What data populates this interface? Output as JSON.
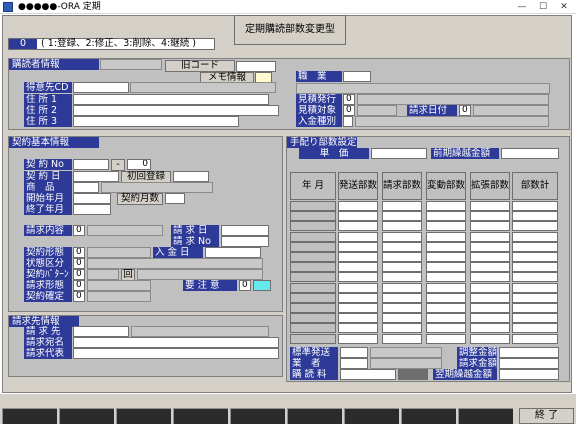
{
  "window": {
    "title": "●●●●●-ORA 定期",
    "buttons": {
      "minimize": "—",
      "maximize": "☐",
      "close": "✕"
    }
  },
  "header": {
    "screen_title": "定期購読部数変更型",
    "mode_value": "0",
    "mode_options": "( 1:登録、2:修正、3:削除、4:継続 )"
  },
  "subscriber": {
    "section_title": "購読者情報",
    "old_code": "旧コード",
    "memo": "メモ情報",
    "tokuisaki_cd": "得意先CD",
    "address1": "住 所 1",
    "address2": "住 所 2",
    "address3": "住 所 3",
    "occupation": "職　業",
    "quote_issue": "見積発行",
    "quote_issue_value": "0",
    "quote_target": "見積対象",
    "quote_target_value": "0",
    "invoice_date": "請求日付",
    "invoice_date_value": "0",
    "payment_type": "入金種別"
  },
  "contract": {
    "section_title": "契約基本情報",
    "contract_no": "契 約 No",
    "contract_no_sep": "-",
    "contract_no_sub": "0",
    "contract_date": "契 約 日",
    "first_register": "初回登録",
    "product": "商　品",
    "start_ym": "開始年月",
    "contract_months": "契約月数",
    "end_ym": "終了年月",
    "billing_content": "請求内容",
    "billing_content_value": "0",
    "billing_day": "請 求 日",
    "billing_no": "請 求 No",
    "contract_form": "契約形態",
    "contract_form_value": "0",
    "payment_day": "入 金 日",
    "status": "状態区分",
    "status_value": "0",
    "contract_pattern": "契約ﾊﾟﾀｰﾝ",
    "contract_pattern_value": "0",
    "times": "回",
    "billing_form": "請求形態",
    "billing_form_value": "0",
    "caution": "要 注 意",
    "caution_value": "0",
    "contract_confirm": "契約確定",
    "contract_confirm_value": "0"
  },
  "billing": {
    "section_title": "請求先情報",
    "billing_to": "請 求 先",
    "billing_addressee": "請求宛名",
    "billing_rep": "請求代表"
  },
  "manual": {
    "section_title": "手配り部数設定",
    "unit_price": "単　価",
    "prev_carryover": "前期繰越金額"
  },
  "grid": {
    "columns": [
      "年 月",
      "発送部数",
      "請求部数",
      "変動部数",
      "拡張部数",
      "部数計"
    ],
    "row_count": 14
  },
  "footer_fields": {
    "standard_shipping": "標準発送",
    "vendor": "業　者",
    "subscription_fee": "購 読 料",
    "adjust_amount": "調整金額",
    "billing_amount": "請求金額",
    "next_carryover": "翌期繰越金額"
  },
  "fkeys": {
    "end": "終 了"
  }
}
